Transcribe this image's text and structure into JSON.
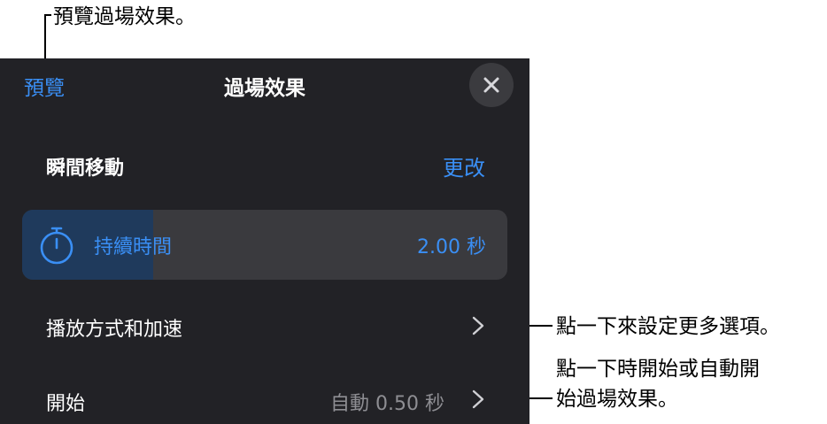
{
  "callouts": {
    "preview": "預覽過場效果。",
    "options": "點一下來設定更多選項。",
    "start_line1": "點一下時開始或自動開",
    "start_line2": "始過場效果。"
  },
  "header": {
    "preview_label": "預覽",
    "title": "過場效果",
    "close_icon": "close-icon"
  },
  "transition": {
    "name": "瞬間移動",
    "change_label": "更改"
  },
  "duration": {
    "label": "持續時間",
    "value": "2.00 秒",
    "icon": "stopwatch-icon",
    "fill_fraction": 0.27
  },
  "rows": {
    "playback": {
      "label": "播放方式和加速"
    },
    "start": {
      "label": "開始",
      "value": "自動  0.50 秒"
    }
  },
  "colors": {
    "panel_bg": "#222226",
    "accent": "#3a8ff5",
    "secondary_text": "#8e8e93"
  }
}
